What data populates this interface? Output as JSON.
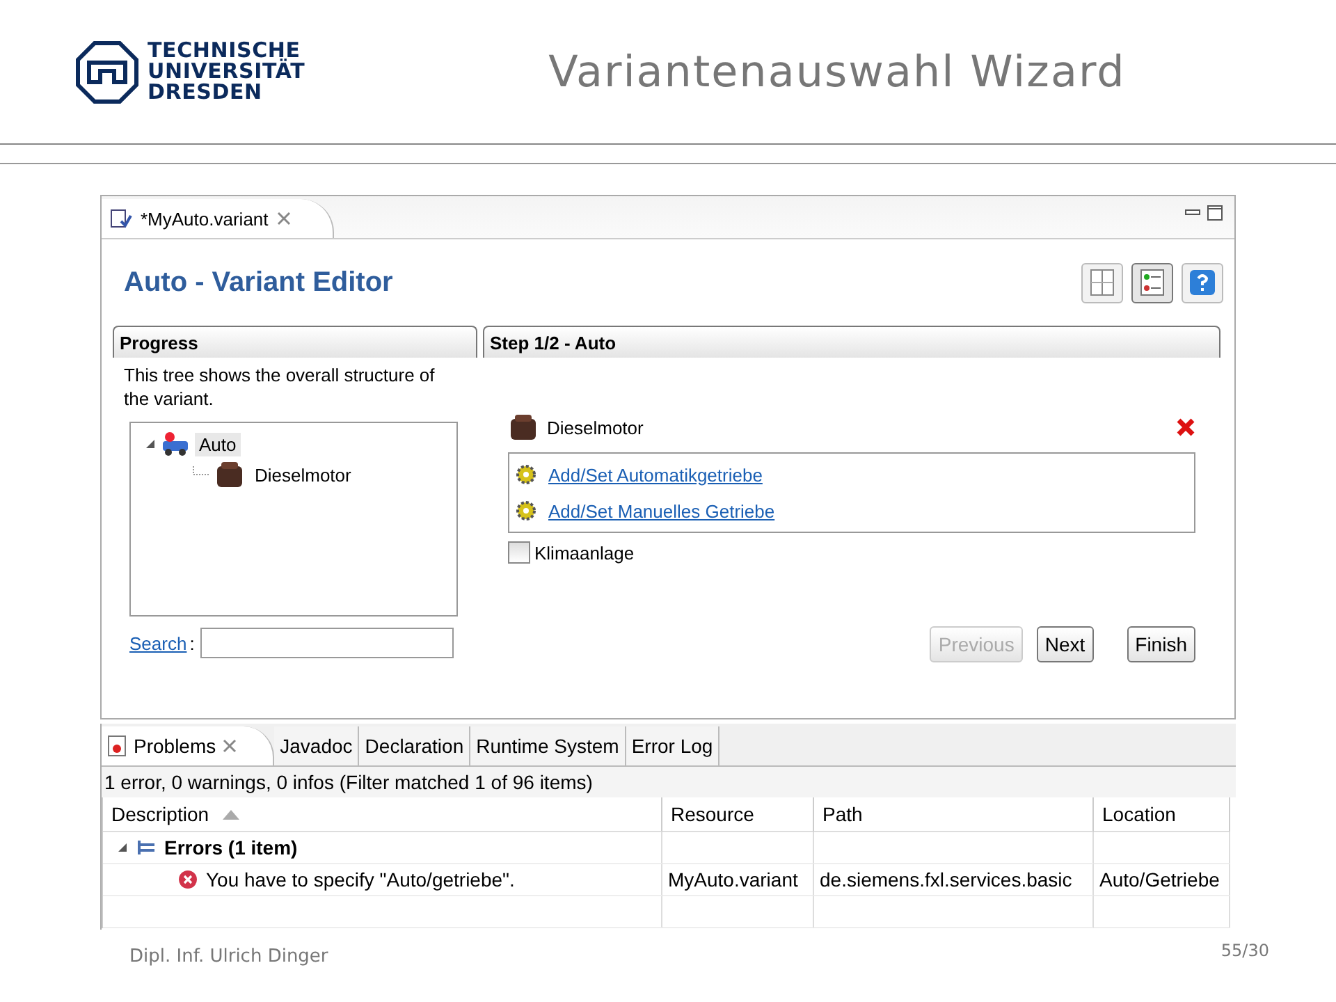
{
  "header": {
    "logo_lines": [
      "TECHNISCHE",
      "UNIVERSITÄT",
      "DRESDEN"
    ],
    "title": "Variantenauswahl Wizard"
  },
  "editor": {
    "tab": {
      "label": "*MyAuto.variant",
      "selected": true
    },
    "title": "Auto - Variant Editor",
    "toolbar_buttons": [
      {
        "kind": "columns",
        "selected": false
      },
      {
        "kind": "list",
        "selected": true
      },
      {
        "kind": "help",
        "selected": false
      }
    ],
    "progress": {
      "heading": "Progress",
      "description": "This tree shows the overall structure of the variant.",
      "tree": [
        {
          "label": "Auto",
          "selected": true,
          "expanded": true,
          "children": [
            {
              "label": "Dieselmotor",
              "selected": false
            }
          ]
        }
      ],
      "search_label": "Search",
      "search_separator": ":"
    },
    "step": {
      "heading": "Step 1/2 - Auto",
      "item": "Dieselmotor",
      "links": [
        "Add/Set Automatikgetriebe",
        "Add/Set Manuelles Getriebe"
      ],
      "checkbox": {
        "label": "Klimaanlage",
        "checked": false
      },
      "buttons": [
        {
          "label": "Previous",
          "disabled": true
        },
        {
          "label": "Next",
          "disabled": false
        },
        {
          "label": "Finish",
          "disabled": false
        }
      ]
    }
  },
  "problems": {
    "tabs": [
      {
        "label": "Problems",
        "selected": true
      },
      {
        "label": "Javadoc",
        "selected": false
      },
      {
        "label": "Declaration",
        "selected": false
      },
      {
        "label": "Runtime System",
        "selected": false
      },
      {
        "label": "Error Log",
        "selected": false
      }
    ],
    "summary": "1 error, 0 warnings, 0 infos (Filter matched 1 of 96 items)",
    "columns": [
      "Description",
      "Resource",
      "Path",
      "Location"
    ],
    "group": {
      "label": "Errors (1 item)",
      "expanded": true
    },
    "rows": [
      {
        "description": "You have to specify \"Auto/getriebe\".",
        "resource": "MyAuto.variant",
        "path": "de.siemens.fxl.services.basic",
        "location": "Auto/Getriebe"
      }
    ]
  },
  "footer": {
    "author": "Dipl. Inf. Ulrich Dinger",
    "page": "55/30"
  }
}
